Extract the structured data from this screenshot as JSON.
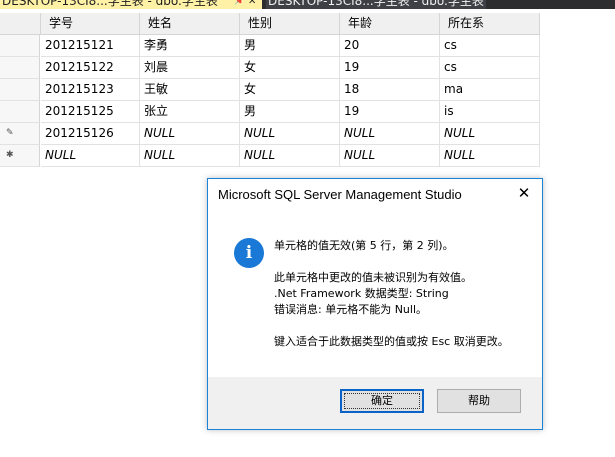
{
  "tabs": [
    {
      "label": "DESKTOP-13CI8...学生表 - dbo.学生表"
    },
    {
      "label": "DESKTOP-13CI8...学生表 - dbo.学生表"
    }
  ],
  "table": {
    "columns": [
      "学号",
      "姓名",
      "性别",
      "年龄",
      "所在系"
    ],
    "rows": [
      {
        "marker": "",
        "cells": [
          "201215121",
          "李勇",
          "男",
          "20",
          "cs"
        ]
      },
      {
        "marker": "",
        "cells": [
          "201215122",
          "刘晨",
          "女",
          "19",
          "cs"
        ]
      },
      {
        "marker": "",
        "cells": [
          "201215123",
          "王敏",
          "女",
          "18",
          "ma"
        ]
      },
      {
        "marker": "",
        "cells": [
          "201215125",
          "张立",
          "男",
          "19",
          "is"
        ]
      },
      {
        "marker": "✎",
        "cells": [
          "201215126",
          "NULL",
          "NULL",
          "NULL",
          "NULL"
        ]
      },
      {
        "marker": "✱",
        "cells": [
          "NULL",
          "NULL",
          "NULL",
          "NULL",
          "NULL"
        ]
      }
    ]
  },
  "dialog": {
    "title": "Microsoft SQL Server Management Studio",
    "icon": "info-icon",
    "line1": "单元格的值无效(第 5 行，第 2 列)。",
    "line2": "此单元格中更改的值未被识别为有效值。",
    "line3": ".Net Framework 数据类型: String",
    "line4": "错误消息: 单元格不能为 Null。",
    "line5": "键入适合于此数据类型的值或按 Esc 取消更改。",
    "ok_label": "确定",
    "help_label": "帮助"
  },
  "colors": {
    "accent": "#1a78d6",
    "tab_active": "#fff1a6",
    "tab_bar": "#2d2d30"
  }
}
